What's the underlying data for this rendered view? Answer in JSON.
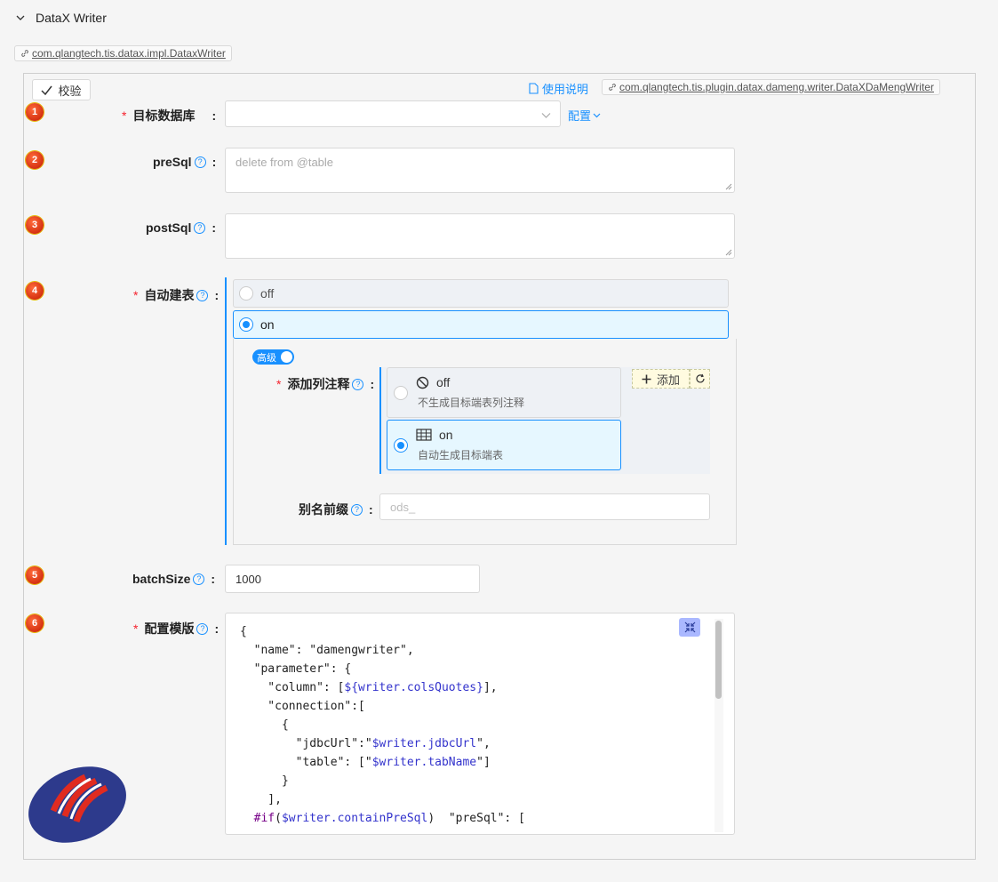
{
  "section": {
    "title": "DataX Writer"
  },
  "writer_class_tag": "com.qlangtech.tis.datax.impl.DataxWriter",
  "toolbar": {
    "verify_label": "校验",
    "help_label": "使用说明",
    "plugin_class_tag": "com.qlangtech.tis.plugin.datax.dameng.writer.DataXDaMengWriter"
  },
  "fields": {
    "target_db": {
      "number": "1",
      "label": "目标数据库",
      "value": "",
      "config_label": "配置"
    },
    "preSql": {
      "number": "2",
      "label": "preSql",
      "placeholder": "delete from @table"
    },
    "postSql": {
      "number": "3",
      "label": "postSql",
      "value": ""
    },
    "auto_create": {
      "number": "4",
      "label": "自动建表",
      "options": [
        {
          "label": "off",
          "selected": false
        },
        {
          "label": "on",
          "selected": true
        }
      ],
      "advanced_label": "高级",
      "advanced_on": true,
      "column_comment": {
        "label": "添加列注释",
        "options": [
          {
            "label": "off",
            "desc": "不生成目标端表列注释",
            "icon": "prohibit-icon",
            "selected": false
          },
          {
            "label": "on",
            "desc": "自动生成目标端表",
            "icon": "table-icon",
            "selected": true
          }
        ],
        "add_label": "添加"
      },
      "alias_prefix": {
        "label": "别名前缀",
        "placeholder": "ods_"
      }
    },
    "batchSize": {
      "number": "5",
      "label": "batchSize",
      "value": "1000"
    },
    "template": {
      "number": "6",
      "label": "配置模版"
    }
  },
  "template_code_lines": [
    "{",
    "  \"name\": \"damengwriter\",",
    "  \"parameter\": {",
    "    \"column\": [${writer.colsQuotes}],",
    "    \"connection\":[",
    "      {",
    "        \"jdbcUrl\":\"$writer.jdbcUrl\",",
    "        \"table\": [\"$writer.tabName\"]",
    "      }",
    "    ],",
    "  #if($writer.containPreSql)  \"preSql\": ["
  ],
  "colors": {
    "accent": "#1890ff",
    "required": "#f5222d",
    "badge": "#d4380d"
  }
}
